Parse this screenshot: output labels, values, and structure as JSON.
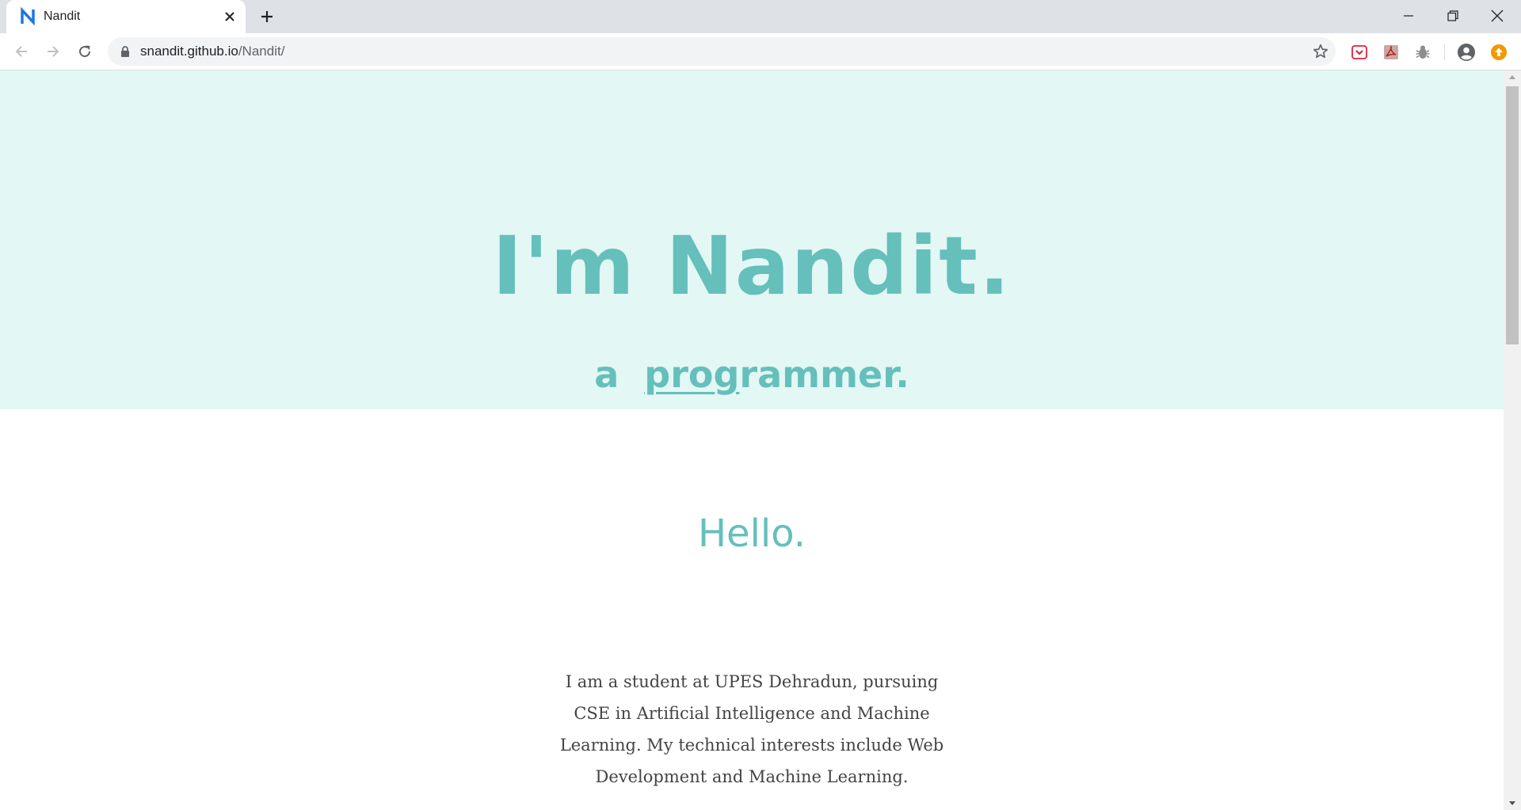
{
  "browser": {
    "tab": {
      "title": "Nandit",
      "favicon": "nandit-n-logo"
    },
    "new_tab_icon": "plus-icon",
    "window_controls": [
      "minimize-icon",
      "restore-icon",
      "close-icon"
    ],
    "nav": [
      "back-arrow-icon",
      "forward-arrow-icon",
      "reload-icon"
    ],
    "address": {
      "host": "snandit.github.io",
      "path": "/Nandit/",
      "secure_icon": "lock-icon"
    },
    "bookmark_icon": "star-icon",
    "extensions": [
      "pocket-icon",
      "pdf-icon",
      "bug-icon"
    ],
    "profile_icon": "account-circle-icon",
    "update_icon": "update-arrow-icon"
  },
  "hero": {
    "title": "I'm Nandit.",
    "subtitle_prefix": "a",
    "subtitle_typed": "programmer."
  },
  "about": {
    "heading": "Hello.",
    "body": "I am a student at UPES Dehradun, pursuing CSE in Artificial Intelligence and Machine Learning. My technical interests include Web Development and Machine Learning."
  },
  "colors": {
    "accent": "#65bfbb",
    "hero_bg": "#e3f7f5",
    "body_text": "#444444"
  }
}
